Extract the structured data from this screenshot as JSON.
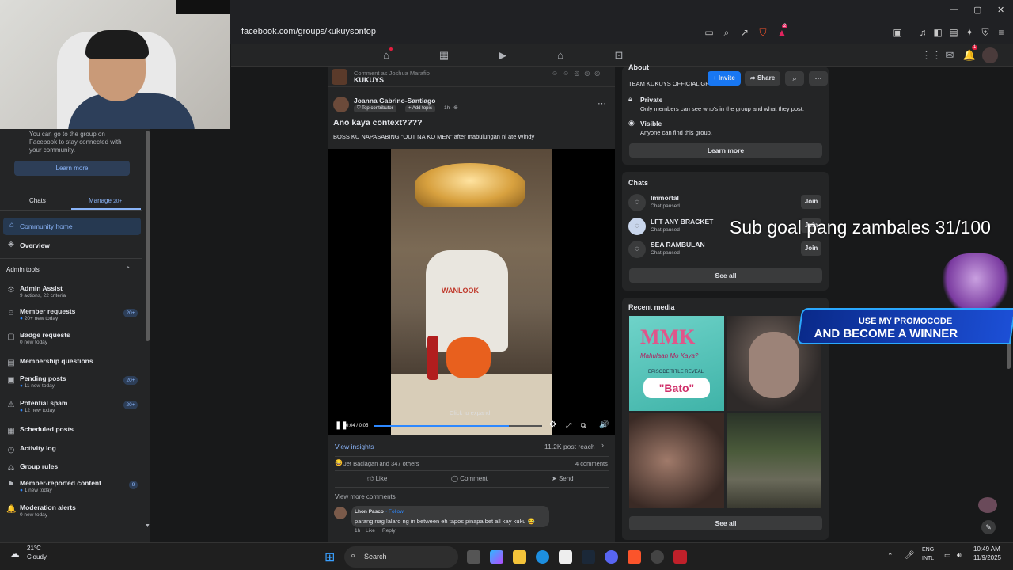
{
  "browser": {
    "url": "facebook.com/groups/kukuysontop",
    "window_controls": {
      "minimize": "—",
      "maximize": "▢",
      "close": "✕"
    },
    "ext_badge": "2"
  },
  "webcam": {},
  "fb_nav": {
    "notification_badge": "1"
  },
  "sidebar": {
    "intro_text": "You can go to the group on Facebook to stay connected with your community.",
    "learn_more": "Learn more",
    "tabs": {
      "chats": "Chats",
      "manage": "Manage",
      "manage_count": "20+"
    },
    "community_home": "Community home",
    "overview": "Overview",
    "admin_tools": "Admin tools",
    "items": [
      {
        "label": "Admin Assist",
        "sub": "9 actions, 22 criteria",
        "badge": ""
      },
      {
        "label": "Member requests",
        "sub": "20+ new today",
        "badge": "20+"
      },
      {
        "label": "Badge requests",
        "sub": "0 new today",
        "badge": ""
      },
      {
        "label": "Membership questions",
        "sub": "",
        "badge": ""
      },
      {
        "label": "Pending posts",
        "sub": "11 new today",
        "badge": "20+"
      },
      {
        "label": "Potential spam",
        "sub": "12 new today",
        "badge": "20+"
      },
      {
        "label": "Scheduled posts",
        "sub": "",
        "badge": ""
      },
      {
        "label": "Activity log",
        "sub": "",
        "badge": ""
      },
      {
        "label": "Group rules",
        "sub": "",
        "badge": ""
      },
      {
        "label": "Member-reported content",
        "sub": "1 new today",
        "badge": "9"
      },
      {
        "label": "Moderation alerts",
        "sub": "0 new today",
        "badge": ""
      }
    ]
  },
  "post": {
    "comment_as": "Comment as Joshua Marafio",
    "group_name": "KUKUYS",
    "author": "Joanna Gabrino-Santiago",
    "author_badge": "Top contributor",
    "add_topic": "+ Add topic",
    "time": "1h",
    "title": "Ano kaya context????",
    "body": "BOSS KU NAPASABING \"OUT NA KO MEN\" after mabulungan ni ate Windy",
    "video": {
      "shirt_text": "WANLOOK",
      "click_to_expand": "Click to expand",
      "time": "0:04 / 0:05",
      "progress": 0.8
    },
    "view_insights": "View insights",
    "reach": "11.2K post reach",
    "reactions": "Jet Baclagan and 347 others",
    "comments_count": "4 comments",
    "actions": {
      "like": "Like",
      "comment": "Comment",
      "send": "Send"
    },
    "view_more_comments": "View more comments",
    "comment": {
      "author": "Lhon Pasco",
      "follow": "Follow",
      "text": "parang nag lalaro ng in between eh tapos pinapa bet all kay kuku 😂",
      "time": "1h",
      "like": "Like",
      "reply": "Reply"
    }
  },
  "right_panel": {
    "about_title": "About",
    "group_title": "TEAM KUKUYS OFFICIAL GR",
    "invite": "+ Invite",
    "share": "Share",
    "private": {
      "title": "Private",
      "desc": "Only members can see who's in the group and what they post."
    },
    "visible": {
      "title": "Visible",
      "desc": "Anyone can find this group."
    },
    "learn_more": "Learn more",
    "chats_title": "Chats",
    "chats": [
      {
        "name": "Immortal",
        "status": "Chat paused",
        "join": "Join"
      },
      {
        "name": "LFT ANY BRACKET",
        "status": "Chat paused",
        "join": "Join"
      },
      {
        "name": "SEA RAMBULAN",
        "status": "Chat paused",
        "join": "Join"
      }
    ],
    "see_all": "See all",
    "recent_media_title": "Recent media",
    "media_mmk": {
      "logo": "MMK",
      "line": "Mahulaan Mo Kaya?",
      "episode": "EPISODE TITLE REVEAL:",
      "title": "\"Bato\""
    },
    "see_all_media": "See all"
  },
  "overlay": {
    "sub_goal": "Sub goal pang zambales 31/100",
    "promo_line1": "USE MY PROMOCODE",
    "promo_line2": "AND BECOME A WINNER"
  },
  "taskbar": {
    "weather_temp": "21°C",
    "weather_desc": "Cloudy",
    "search": "Search",
    "lang1": "ENG",
    "lang2": "INTL",
    "time": "10:49 AM",
    "date": "11/9/2025"
  }
}
